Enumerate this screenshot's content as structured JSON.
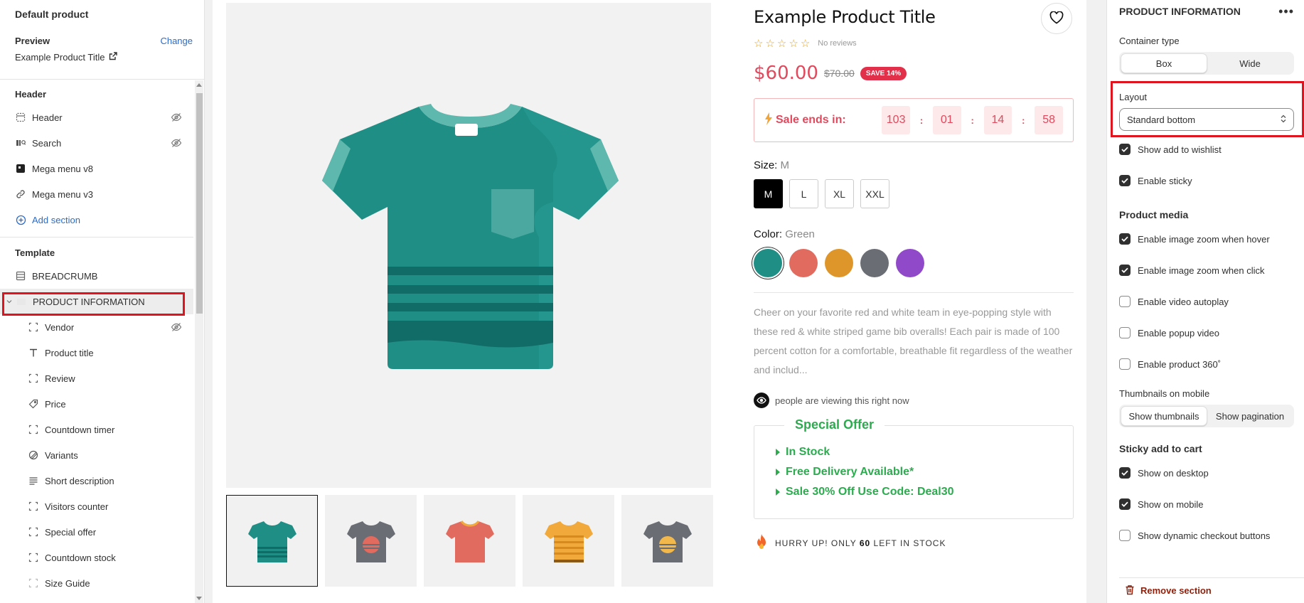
{
  "sidebar": {
    "title": "Default product",
    "preview_label": "Preview",
    "change_label": "Change",
    "preview_value": "Example Product Title",
    "header_section": "Header",
    "header_items": [
      {
        "label": "Header",
        "icon": "layout-icon",
        "hidden": true
      },
      {
        "label": "Search",
        "icon": "search-section-icon",
        "hidden": true
      },
      {
        "label": "Mega menu v8",
        "icon": "app-block-icon",
        "hidden": false
      },
      {
        "label": "Mega menu v3",
        "icon": "link-icon",
        "hidden": false
      }
    ],
    "add_section": "Add section",
    "template_section": "Template",
    "template_items": [
      {
        "label": "BREADCRUMB",
        "icon": "layout-icon"
      },
      {
        "label": "PRODUCT INFORMATION",
        "icon": "product-icon"
      }
    ],
    "blocks": [
      {
        "label": "Vendor",
        "icon": "block-icon",
        "hidden": true
      },
      {
        "label": "Product title",
        "icon": "text-icon",
        "hidden": false
      },
      {
        "label": "Review",
        "icon": "block-icon",
        "hidden": false
      },
      {
        "label": "Price",
        "icon": "price-tag-icon",
        "hidden": false
      },
      {
        "label": "Countdown timer",
        "icon": "block-icon",
        "hidden": false
      },
      {
        "label": "Variants",
        "icon": "variants-icon",
        "hidden": false
      },
      {
        "label": "Short description",
        "icon": "text-align-icon",
        "hidden": false
      },
      {
        "label": "Visitors counter",
        "icon": "block-icon",
        "hidden": false
      },
      {
        "label": "Special offer",
        "icon": "block-icon",
        "hidden": false
      },
      {
        "label": "Countdown stock",
        "icon": "block-icon",
        "hidden": false
      },
      {
        "label": "Size Guide",
        "icon": "block-icon",
        "hidden": false
      }
    ]
  },
  "product": {
    "title": "Example Product Title",
    "reviews": "No reviews",
    "rating": 0,
    "price": "$60.00",
    "compare_price": "$70.00",
    "save_badge": "SAVE 14%",
    "countdown_label": "Sale ends in:",
    "countdown": [
      "103",
      "01",
      "14",
      "58"
    ],
    "size_label": "Size:",
    "size_value": "M",
    "sizes": [
      "M",
      "L",
      "XL",
      "XXL"
    ],
    "color_label": "Color:",
    "color_value": "Green",
    "colors": [
      "#1f8f86",
      "#e26b5f",
      "#de962b",
      "#6a6d74",
      "#9049c8"
    ],
    "description": "Cheer on your favorite red and white team in eye-popping style with these red & white striped game bib overalls! Each pair is made of 100 percent cotton for a comfortable, breathable fit regardless of the weather and includ...",
    "viewers": "people are viewing this right now",
    "offer_title": "Special Offer",
    "offer_lines": [
      "In Stock",
      "Free Delivery Available*",
      "Sale 30% Off Use Code: Deal30"
    ],
    "hurry_prefix": "HURRY UP! ONLY",
    "hurry_count": "60",
    "hurry_suffix": "LEFT IN STOCK"
  },
  "settings": {
    "title": "PRODUCT INFORMATION",
    "container_label": "Container type",
    "container_options": [
      "Box",
      "Wide"
    ],
    "container_selected": "Box",
    "layout_label": "Layout",
    "layout_value": "Standard bottom",
    "checks_top": [
      {
        "label": "Show add to wishlist",
        "checked": true
      },
      {
        "label": "Enable sticky",
        "checked": true
      }
    ],
    "media_title": "Product media",
    "checks_media": [
      {
        "label": "Enable image zoom when hover",
        "checked": true
      },
      {
        "label": "Enable image zoom when click",
        "checked": true
      },
      {
        "label": "Enable video autoplay",
        "checked": false
      },
      {
        "label": "Enable popup video",
        "checked": false
      },
      {
        "label": "Enable product 360˚",
        "checked": false
      }
    ],
    "thumbs_label": "Thumbnails on mobile",
    "thumbs_options": [
      "Show thumbnails",
      "Show pagination"
    ],
    "thumbs_selected": "Show thumbnails",
    "sticky_title": "Sticky add to cart",
    "checks_sticky": [
      {
        "label": "Show on desktop",
        "checked": true
      },
      {
        "label": "Show on mobile",
        "checked": true
      },
      {
        "label": "Show dynamic checkout buttons",
        "checked": false
      }
    ],
    "remove_label": "Remove section"
  },
  "colors": {
    "accent": "#2a6ccb",
    "sale": "#e2495d",
    "offer": "#2cab4f",
    "highlight": "#e0141e"
  }
}
